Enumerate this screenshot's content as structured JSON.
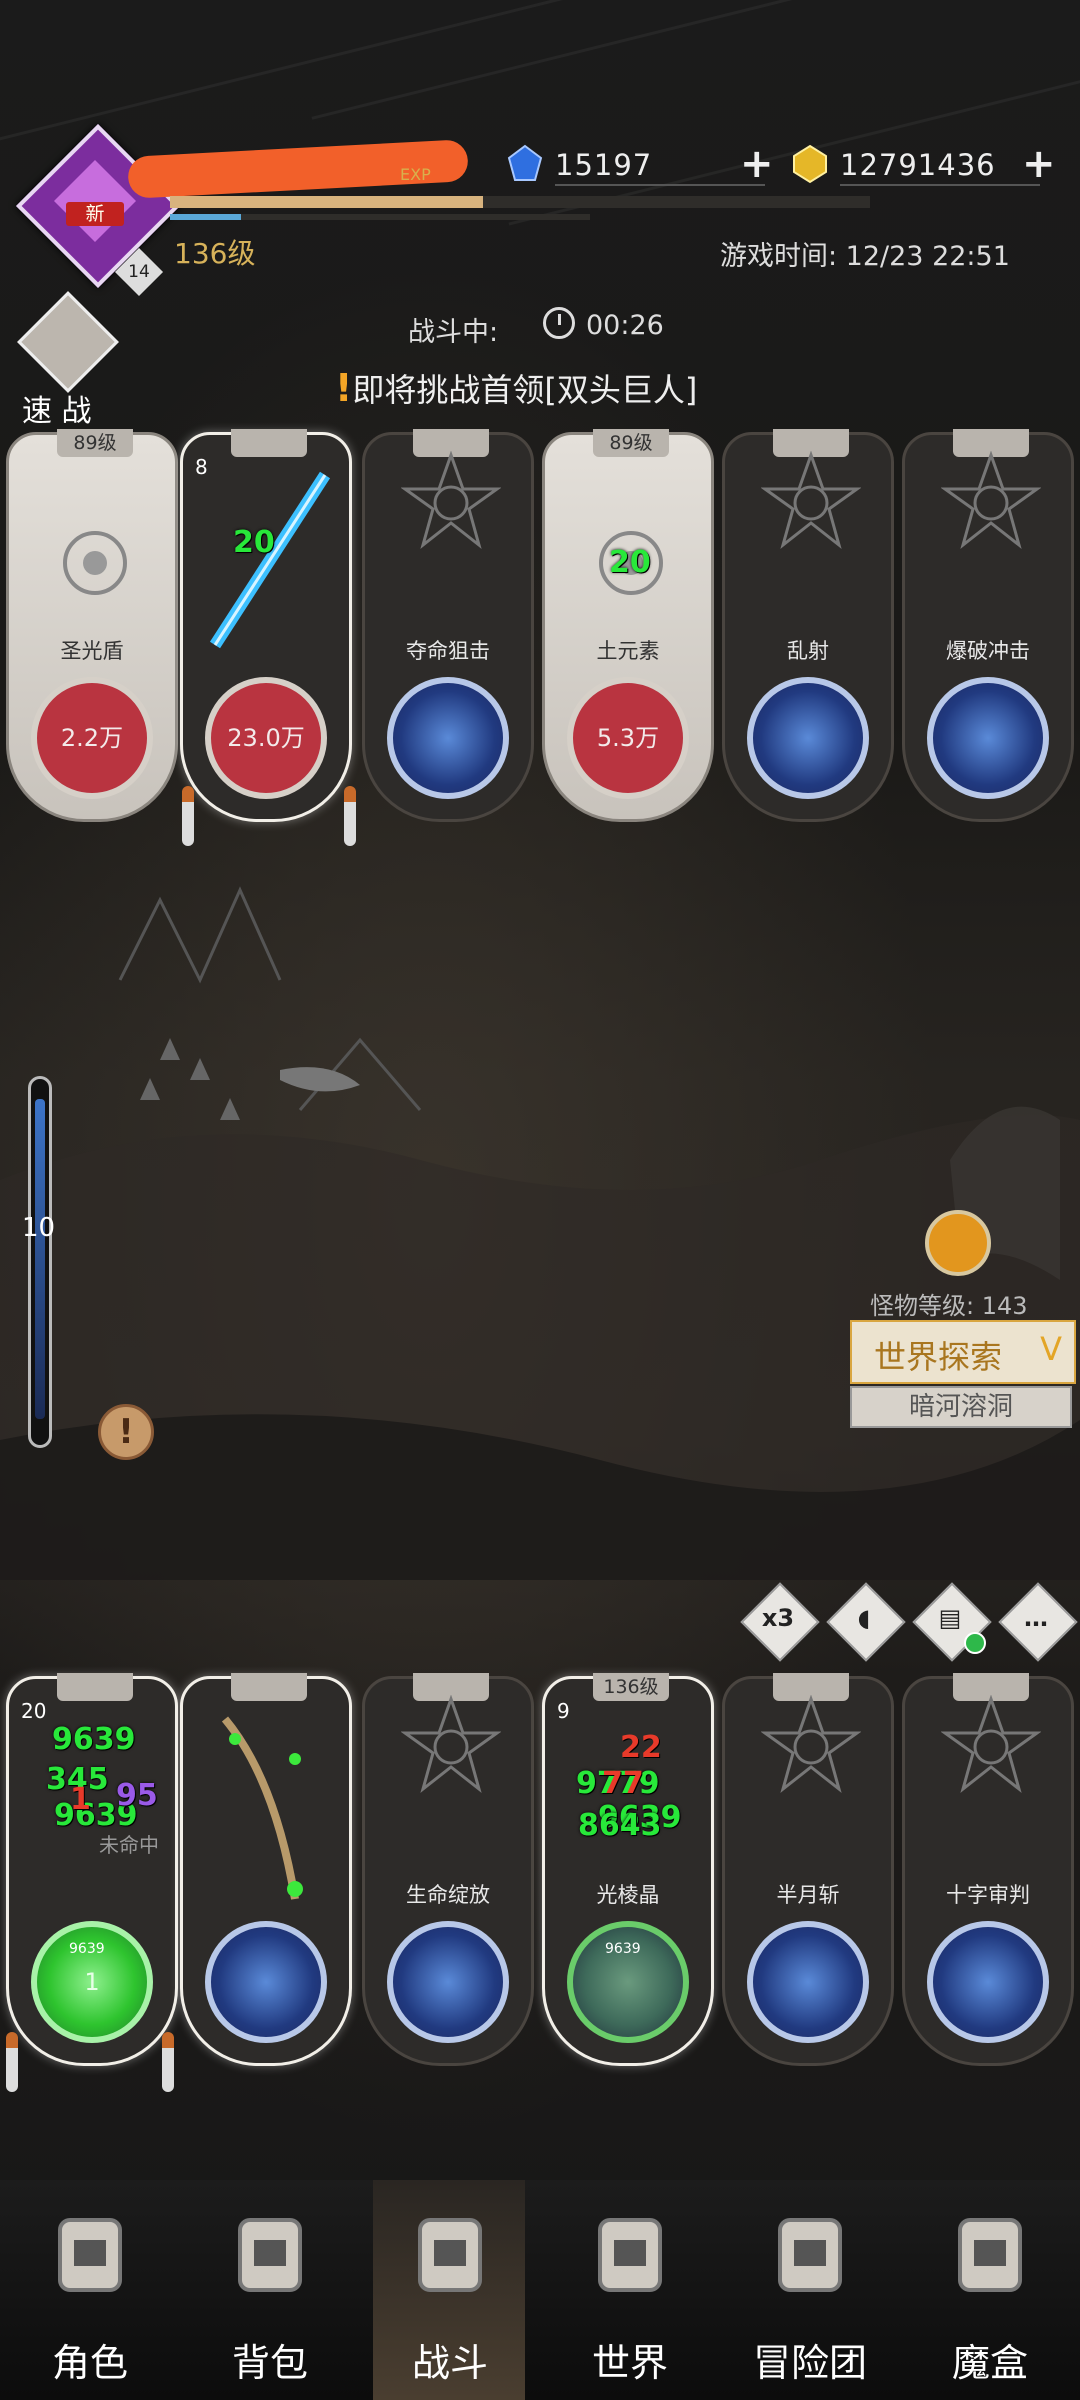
{
  "header": {
    "avatar_badge": "新",
    "avatar_level": "14",
    "exp_label": "EXP",
    "level_text": "136级",
    "exp_fill": 0.19,
    "hp_fill": 0.08,
    "game_time": "游戏时间: 12/23 22:51"
  },
  "currency": {
    "diamonds": "15197",
    "gold": "12791436"
  },
  "battle": {
    "status": "战斗中:",
    "timer": "00:26",
    "quick_battle": "速 战",
    "alert_mark": "!",
    "alert": "即将挑战首领[双头巨人]"
  },
  "enemy_cards": [
    {
      "tag": "89级",
      "name": "圣光盾",
      "value": "2.2万",
      "style": "light"
    },
    {
      "tag": "",
      "name": "",
      "value": "23.0万",
      "style": "hero",
      "count": "8",
      "damage": "20"
    },
    {
      "tag": "",
      "name": "夺命狙击",
      "value": "",
      "style": "skill",
      "icon": "target-skill-icon"
    },
    {
      "tag": "89级",
      "name": "土元素",
      "value": "5.3万",
      "style": "light",
      "damage": "20"
    },
    {
      "tag": "",
      "name": "乱射",
      "value": "",
      "style": "skill",
      "icon": "barrage-skill-icon"
    },
    {
      "tag": "",
      "name": "爆破冲击",
      "value": "",
      "style": "skill",
      "icon": "blast-skill-icon"
    }
  ],
  "player_cards": [
    {
      "tag": "",
      "name": "",
      "value": "1",
      "style": "hero-green",
      "count": "20",
      "small": "9639",
      "partial": "未命中"
    },
    {
      "tag": "",
      "name": "",
      "value": "",
      "style": "weapon",
      "icon": "sword-skill-icon"
    },
    {
      "tag": "",
      "name": "生命绽放",
      "value": "",
      "style": "skill",
      "icon": "lotus-skill-icon"
    },
    {
      "tag": "136级",
      "name": "光棱晶",
      "value": "",
      "style": "crystal",
      "count": "9",
      "small": "9639"
    },
    {
      "tag": "",
      "name": "半月斩",
      "value": "",
      "style": "skill",
      "icon": "crescent-skill-icon"
    },
    {
      "tag": "",
      "name": "十字审判",
      "value": "",
      "style": "skill",
      "icon": "cross-skill-icon"
    }
  ],
  "floating_numbers": {
    "card1": [
      "9639",
      "345",
      "9639",
      "1",
      "95"
    ],
    "card4_green": [
      "9779",
      "9639",
      "8643"
    ],
    "card4_red": [
      "22",
      "77"
    ]
  },
  "map": {
    "slider_value": "10",
    "monster_level": "怪物等级: 143",
    "world_explore": "世界探索",
    "world_explore_icon": "V",
    "location": "暗河溶洞",
    "exclaim": "!"
  },
  "actions": {
    "speed": "x3"
  },
  "nav": [
    {
      "label": "角色",
      "icon": "helmet-icon"
    },
    {
      "label": "背包",
      "icon": "backpack-icon"
    },
    {
      "label": "战斗",
      "icon": "shield-swords-icon",
      "selected": true
    },
    {
      "label": "世界",
      "icon": "map-scroll-icon"
    },
    {
      "label": "冒险团",
      "icon": "castle-icon"
    },
    {
      "label": "魔盒",
      "icon": "magic-box-icon"
    }
  ],
  "colors": {
    "accent_gold": "#d7b25a",
    "hp_red": "#b93440",
    "heal_green": "#28e83a",
    "crit_red": "#e83a2a"
  }
}
